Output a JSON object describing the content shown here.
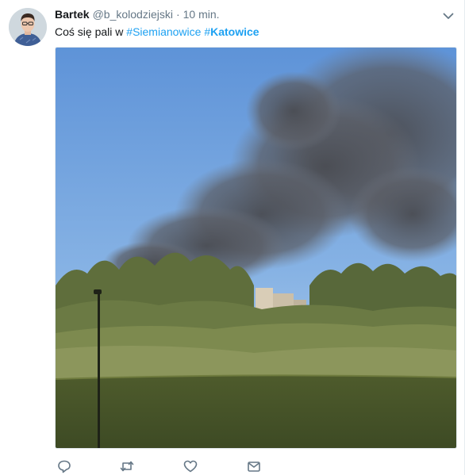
{
  "tweet": {
    "author_name": "Bartek",
    "author_handle": "@b_kolodziejski",
    "separator": "·",
    "timestamp": "10 min.",
    "text_prefix": "Coś się pali w ",
    "hashtags": [
      {
        "hash": "#",
        "tag": "Siemianowice",
        "bold": false
      },
      {
        "hash": "#",
        "tag": "Katowice",
        "bold": true
      }
    ]
  },
  "actions": {
    "reply_icon": "speech-bubble-icon",
    "retweet_icon": "retweet-arrows-icon",
    "like_icon": "heart-icon",
    "message_icon": "envelope-icon"
  },
  "colors": {
    "link": "#1da1f2",
    "secondary_text": "#657786",
    "icon": "#657786",
    "primary_text": "#14171a"
  }
}
